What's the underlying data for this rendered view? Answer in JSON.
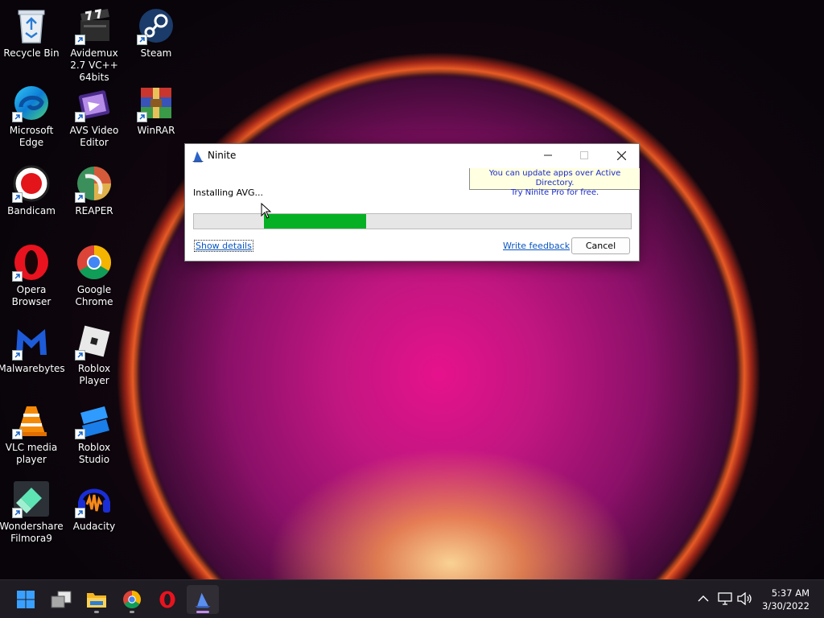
{
  "desktop": {
    "icons": [
      {
        "label": "Recycle Bin",
        "icon": "recycle-bin-icon"
      },
      {
        "label": "Avidemux 2.7 VC++ 64bits",
        "icon": "avidemux-icon"
      },
      {
        "label": "Steam",
        "icon": "steam-icon"
      },
      {
        "label": "Microsoft Edge",
        "icon": "edge-icon"
      },
      {
        "label": "AVS Video Editor",
        "icon": "avs-video-editor-icon"
      },
      {
        "label": "WinRAR",
        "icon": "winrar-icon"
      },
      {
        "label": "Bandicam",
        "icon": "bandicam-icon"
      },
      {
        "label": "REAPER",
        "icon": "reaper-icon"
      },
      {
        "label": "Opera Browser",
        "icon": "opera-icon"
      },
      {
        "label": "Google Chrome",
        "icon": "chrome-icon"
      },
      {
        "label": "Malwarebytes",
        "icon": "malwarebytes-icon"
      },
      {
        "label": "Roblox Player",
        "icon": "roblox-player-icon"
      },
      {
        "label": "VLC media player",
        "icon": "vlc-icon"
      },
      {
        "label": "Roblox Studio",
        "icon": "roblox-studio-icon"
      },
      {
        "label": "Wondershare Filmora9",
        "icon": "filmora-icon"
      },
      {
        "label": "Audacity",
        "icon": "audacity-icon"
      }
    ]
  },
  "ninite": {
    "title": "Ninite",
    "tooltip_line1": "You can update apps over Active Directory.",
    "tooltip_line2": "Try Ninite Pro for free.",
    "status": "Installing AVG...",
    "progress": {
      "start_fraction": 0.161,
      "fill_fraction": 0.233
    },
    "show_details": "Show details",
    "write_feedback": "Write feedback",
    "cancel": "Cancel",
    "colors": {
      "progress": "#06b025",
      "link": "#0a56c2",
      "tooltip_text": "#1a2ac8",
      "tooltip_bg": "#ffffe1"
    }
  },
  "taskbar": {
    "items": [
      "windows-start-icon",
      "task-view-icon",
      "file-explorer-icon",
      "chrome-icon",
      "opera-icon",
      "ninite-icon"
    ],
    "time": "5:37 AM",
    "date": "3/30/2022",
    "tray_icons": [
      "chevron-up-icon",
      "network-icon",
      "speaker-icon"
    ]
  }
}
